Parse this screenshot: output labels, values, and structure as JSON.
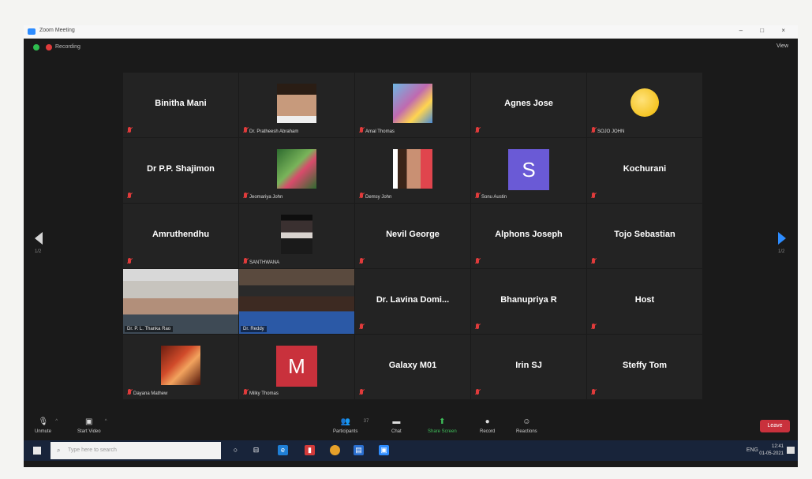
{
  "window": {
    "title": "Zoom Meeting",
    "controls": "– □ ×"
  },
  "topbar": {
    "recording_label": "Recording",
    "view_label": "View"
  },
  "pager": {
    "left": "1/2",
    "right": "1/2"
  },
  "tiles": [
    {
      "type": "name",
      "name": "Binitha Mani"
    },
    {
      "type": "pic",
      "pic": "p-face",
      "label": "Dr. Pratheesh Abraham"
    },
    {
      "type": "pic",
      "pic": "p-kids",
      "label": "Amal Thomas"
    },
    {
      "type": "name",
      "name": "Agnes Jose"
    },
    {
      "type": "pic",
      "pic": "p-smile",
      "label": "SOJO JOHN"
    },
    {
      "type": "name",
      "name": "Dr P.P. Shajimon"
    },
    {
      "type": "pic",
      "pic": "p-green",
      "label": "Jeomariya John"
    },
    {
      "type": "pic",
      "pic": "p-woman",
      "label": "Demsy John"
    },
    {
      "type": "letter",
      "letter": "S",
      "av": "av-s",
      "label": "Sonu Austin"
    },
    {
      "type": "name",
      "name": "Kochurani"
    },
    {
      "type": "name",
      "name": "Amruthendhu"
    },
    {
      "type": "pic",
      "pic": "p-girl",
      "label": "SANTHWANA"
    },
    {
      "type": "name",
      "name": "Nevil George"
    },
    {
      "type": "name",
      "name": "Alphons Joseph"
    },
    {
      "type": "name",
      "name": "Tojo Sebastian"
    },
    {
      "type": "video",
      "video": "video-a",
      "label": "Dr. P. L. Thanka Rao"
    },
    {
      "type": "video",
      "video": "video-b",
      "label": "Dr. Reddy"
    },
    {
      "type": "name",
      "name": "Dr. Lavina Domi..."
    },
    {
      "type": "name",
      "name": "Bhanupriya R"
    },
    {
      "type": "name",
      "name": "Host"
    },
    {
      "type": "pic",
      "pic": "p-dance",
      "label": "Dayana Mathew"
    },
    {
      "type": "letter",
      "letter": "M",
      "av": "av-m",
      "label": "Milky Thomas"
    },
    {
      "type": "name",
      "name": "Galaxy M01"
    },
    {
      "type": "name",
      "name": "Irin SJ"
    },
    {
      "type": "name",
      "name": "Steffy Tom"
    }
  ],
  "controls": {
    "unmute": "Unmute",
    "start_video": "Start Video",
    "participants": "Participants",
    "participants_count": "37",
    "chat": "Chat",
    "share_screen": "Share Screen",
    "record": "Record",
    "reactions": "Reactions",
    "leave": "Leave"
  },
  "taskbar": {
    "search_placeholder": "Type here to search",
    "tray_text": "ENG",
    "time": "12:41",
    "date": "01-05-2021"
  }
}
